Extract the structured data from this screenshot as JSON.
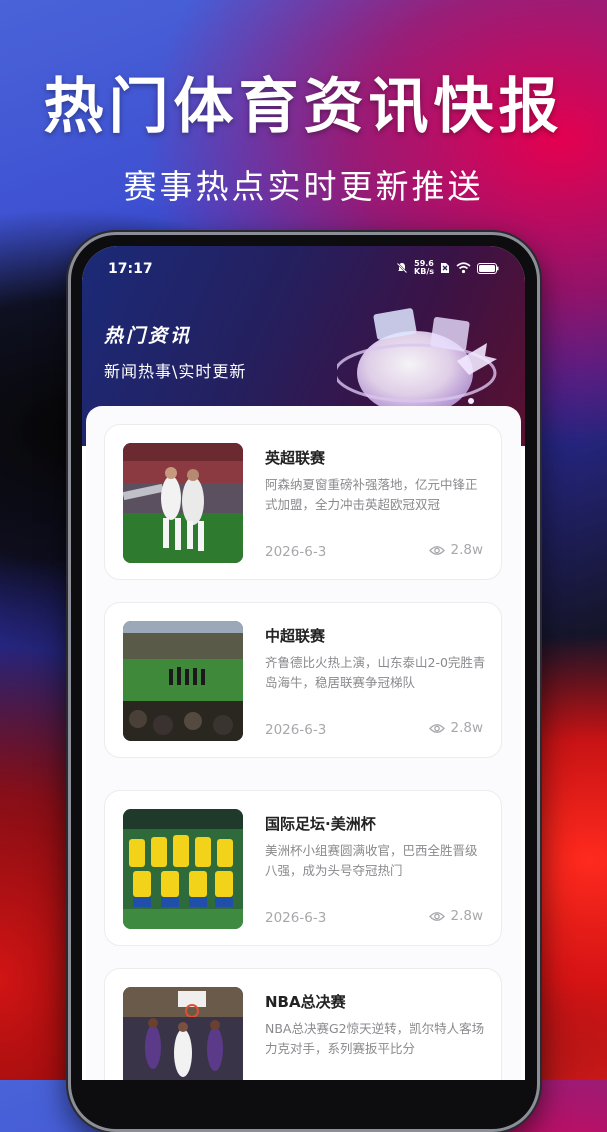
{
  "hero": {
    "title": "热门体育资讯快报",
    "subtitle": "赛事热点实时更新推送"
  },
  "status_bar": {
    "time": "17:17",
    "net_speed_value": "59.6",
    "net_speed_unit": "KB/s"
  },
  "app": {
    "title": "热门资讯",
    "subtitle": "新闻热事\\实时更新"
  },
  "news": [
    {
      "title": "英超联赛",
      "desc": "阿森纳夏窗重磅补强落地，亿元中锋正式加盟，全力冲击英超欧冠双冠",
      "date": "2026-6-3",
      "views": "2.8w"
    },
    {
      "title": "中超联赛",
      "desc": "齐鲁德比火热上演，山东泰山2-0完胜青岛海牛，稳居联赛争冠梯队",
      "date": "2026-6-3",
      "views": "2.8w"
    },
    {
      "title": "国际足坛·美洲杯",
      "desc": "美洲杯小组赛圆满收官，巴西全胜晋级八强，成为头号夺冠热门",
      "date": "2026-6-3",
      "views": "2.8w"
    },
    {
      "title": "NBA总决赛",
      "desc": "NBA总决赛G2惊天逆转，凯尔特人客场力克对手，系列赛扳平比分",
      "date": "",
      "views": ""
    }
  ],
  "colors": {
    "header_start": "#1b2a78",
    "header_end": "#5a1030",
    "title_text": "#222222",
    "meta_text": "#a8a8ac"
  }
}
